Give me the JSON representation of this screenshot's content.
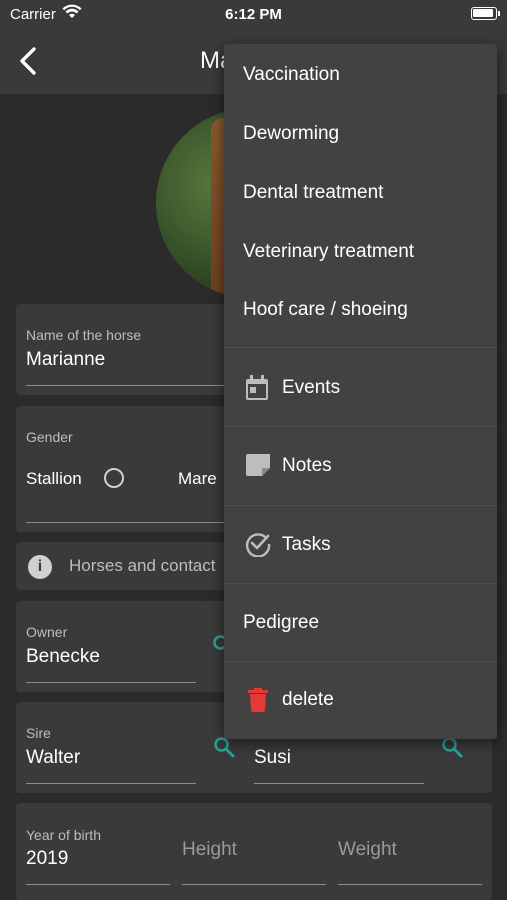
{
  "status_bar": {
    "carrier": "Carrier",
    "time": "6:12 PM"
  },
  "app_bar": {
    "title": "Ma"
  },
  "form": {
    "horse_name": {
      "label": "Name of the horse",
      "value": "Marianne"
    },
    "gender": {
      "label": "Gender",
      "option_stallion": "Stallion",
      "option_mare": "Mare"
    },
    "info": {
      "text": "Horses and contact"
    },
    "owner": {
      "label": "Owner",
      "value": "Benecke"
    },
    "sire": {
      "label": "Sire",
      "value": "Walter"
    },
    "dam": {
      "value": "Susi"
    },
    "year_of_birth": {
      "label": "Year of birth",
      "value": "2019"
    },
    "height": {
      "placeholder": "Height"
    },
    "weight": {
      "placeholder": "Weight"
    }
  },
  "menu": {
    "items": [
      {
        "label": "Vaccination"
      },
      {
        "label": "Deworming"
      },
      {
        "label": "Dental treatment"
      },
      {
        "label": "Veterinary treatment"
      },
      {
        "label": "Hoof care / shoeing"
      },
      {
        "label": "Events",
        "icon": "calendar-icon"
      },
      {
        "label": "Notes",
        "icon": "note-icon"
      },
      {
        "label": "Tasks",
        "icon": "check-circle-icon"
      },
      {
        "label": "Pedigree"
      },
      {
        "label": "delete",
        "icon": "trash-icon"
      }
    ]
  },
  "colors": {
    "accent": "#26a69a",
    "danger": "#e53935",
    "background": "#2b2b2b",
    "surface": "#3a3a3a",
    "menu": "#424242"
  }
}
